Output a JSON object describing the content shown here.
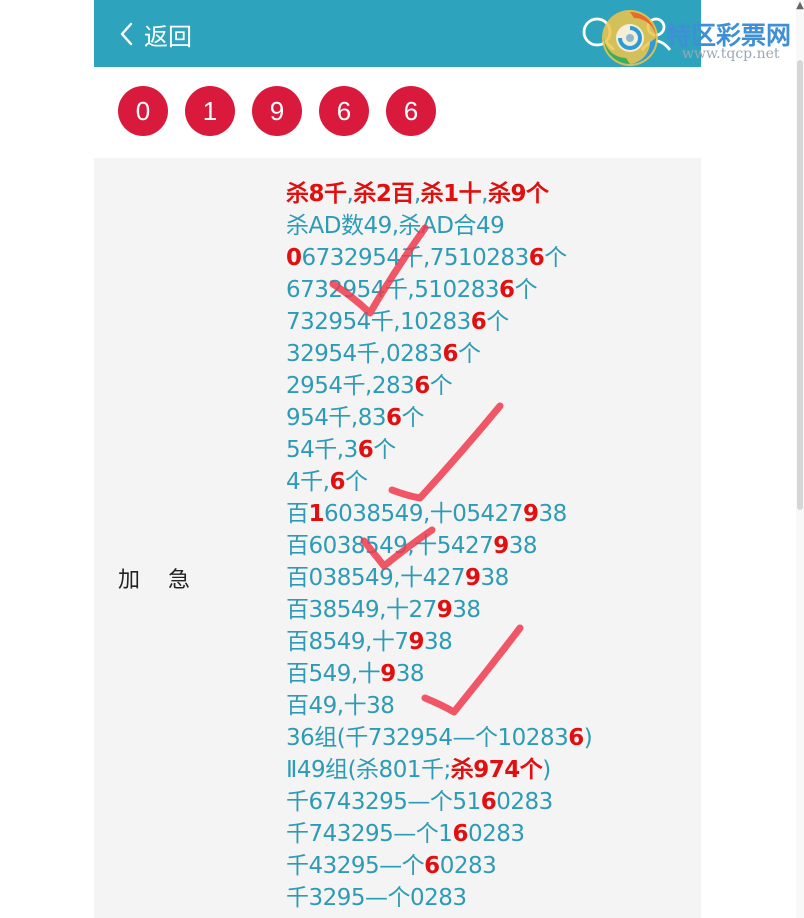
{
  "header": {
    "back_label": "返回"
  },
  "logo": {
    "name": "特区彩票网",
    "url": "www.tqcp.net"
  },
  "balls": [
    "0",
    "1",
    "9",
    "6",
    "6"
  ],
  "row_label": "加    急",
  "lines": [
    [
      {
        "t": "杀8千",
        "r": 1
      },
      {
        "t": ","
      },
      {
        "t": "杀2百",
        "r": 1
      },
      {
        "t": ","
      },
      {
        "t": "杀1十",
        "r": 1
      },
      {
        "t": ","
      },
      {
        "t": "杀9个",
        "r": 1
      }
    ],
    [
      {
        "t": "杀AD数49,杀AD合49"
      }
    ],
    [
      {
        "t": "0",
        "r": 1
      },
      {
        "t": "6732954千,751028"
      },
      {
        "t": "3"
      },
      {
        "t": "6",
        "r": 1
      },
      {
        "t": "个"
      }
    ],
    [
      {
        "t": "6732954千,510283"
      },
      {
        "t": "6",
        "r": 1
      },
      {
        "t": "个"
      }
    ],
    [
      {
        "t": "732954千,10283"
      },
      {
        "t": "6",
        "r": 1
      },
      {
        "t": "个"
      }
    ],
    [
      {
        "t": "32954千,0283"
      },
      {
        "t": "6",
        "r": 1
      },
      {
        "t": "个"
      }
    ],
    [
      {
        "t": "2954千,283"
      },
      {
        "t": "6",
        "r": 1
      },
      {
        "t": "个"
      }
    ],
    [
      {
        "t": "954千,83"
      },
      {
        "t": "6",
        "r": 1
      },
      {
        "t": "个"
      }
    ],
    [
      {
        "t": "54千,3"
      },
      {
        "t": "6",
        "r": 1
      },
      {
        "t": "个"
      }
    ],
    [
      {
        "t": "4千,"
      },
      {
        "t": "6",
        "r": 1
      },
      {
        "t": "个"
      }
    ],
    [
      {
        "t": "百"
      },
      {
        "t": "1",
        "r": 1
      },
      {
        "t": "6038549,十05427"
      },
      {
        "t": "9",
        "r": 1
      },
      {
        "t": "38"
      }
    ],
    [
      {
        "t": "百6038549,十5427"
      },
      {
        "t": "9",
        "r": 1
      },
      {
        "t": "38"
      }
    ],
    [
      {
        "t": "百038549,十427"
      },
      {
        "t": "9",
        "r": 1
      },
      {
        "t": "38"
      }
    ],
    [
      {
        "t": "百38549,十27"
      },
      {
        "t": "9",
        "r": 1
      },
      {
        "t": "38"
      }
    ],
    [
      {
        "t": "百8549,十7"
      },
      {
        "t": "9",
        "r": 1
      },
      {
        "t": "38"
      }
    ],
    [
      {
        "t": "百549,十"
      },
      {
        "t": "9",
        "r": 1
      },
      {
        "t": "38"
      }
    ],
    [
      {
        "t": "百49,十38"
      }
    ],
    [
      {
        "t": "36组(千732954—个10283"
      },
      {
        "t": "6",
        "r": 1
      },
      {
        "t": ")"
      }
    ],
    [
      {
        "t": "Ⅱ49组(杀801千;"
      },
      {
        "t": "杀974个",
        "r": 1
      },
      {
        "t": ")"
      }
    ],
    [
      {
        "t": "千6743295—个51"
      },
      {
        "t": "6",
        "r": 1
      },
      {
        "t": "0283"
      }
    ],
    [
      {
        "t": "千743295—个1"
      },
      {
        "t": "6",
        "r": 1
      },
      {
        "t": "0283"
      }
    ],
    [
      {
        "t": "千43295—个"
      },
      {
        "t": "6",
        "r": 1
      },
      {
        "t": "0283"
      }
    ],
    [
      {
        "t": "千3295—个0283"
      }
    ]
  ],
  "colors": {
    "header_bg": "#2ea3be",
    "ball_bg": "#d91a3c",
    "text_teal": "#2e9bb6",
    "text_red": "#e01010",
    "check_stroke": "#ee3a4c"
  },
  "icons": [
    "chevron-left-icon",
    "search-icon",
    "user-icon",
    "logo-swirl-icon",
    "check-mark-icon"
  ]
}
